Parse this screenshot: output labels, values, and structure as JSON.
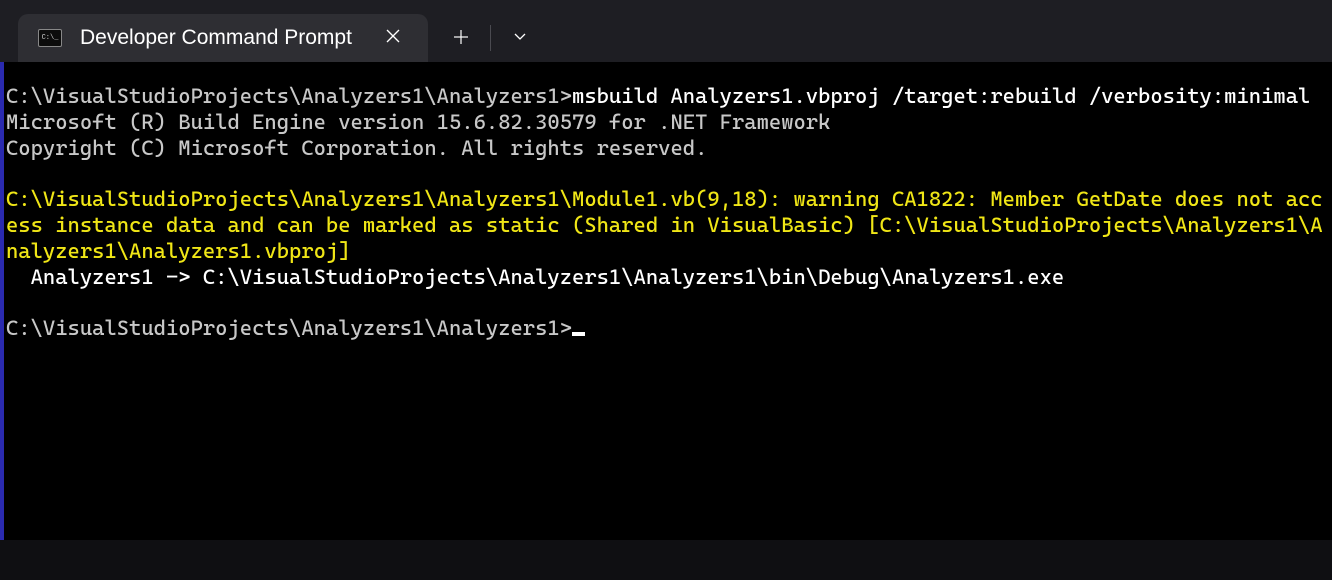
{
  "tab": {
    "title": "Developer Command Prompt"
  },
  "terminal": {
    "line1_prompt": "C:\\VisualStudioProjects\\Analyzers1\\Analyzers1>",
    "line1_cmd": "msbuild Analyzers1.vbproj /target:rebuild /verbosity:minimal",
    "line2": "Microsoft (R) Build Engine version 15.6.82.30579 for .NET Framework",
    "line3": "Copyright (C) Microsoft Corporation. All rights reserved.",
    "warning": "C:\\VisualStudioProjects\\Analyzers1\\Analyzers1\\Module1.vb(9,18): warning CA1822: Member GetDate does not access instance data and can be marked as static (Shared in VisualBasic) [C:\\VisualStudioProjects\\Analyzers1\\Analyzers1\\Analyzers1.vbproj]",
    "output": "  Analyzers1 -> C:\\VisualStudioProjects\\Analyzers1\\Analyzers1\\bin\\Debug\\Analyzers1.exe",
    "prompt2": "C:\\VisualStudioProjects\\Analyzers1\\Analyzers1>"
  }
}
